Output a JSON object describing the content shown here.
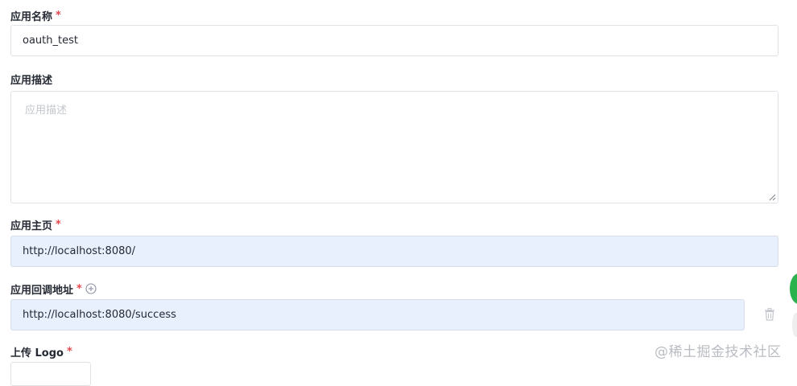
{
  "form": {
    "app_name": {
      "label": "应用名称",
      "required_mark": "*",
      "value": "oauth_test"
    },
    "app_desc": {
      "label": "应用描述",
      "placeholder": "应用描述",
      "value": ""
    },
    "app_home": {
      "label": "应用主页",
      "required_mark": "*",
      "value": "http://localhost:8080/"
    },
    "callback": {
      "label": "应用回调地址",
      "required_mark": "*",
      "value": "http://localhost:8080/success",
      "add_icon": "plus-circle-icon",
      "delete_icon": "trash-icon"
    },
    "logo": {
      "label": "上传 Logo",
      "required_mark": "*"
    }
  },
  "watermark": "@稀土掘金技术社区",
  "colors": {
    "required": "#e5484d",
    "autofill_bg": "#e8f0fe",
    "side_button": "#2bb24c"
  }
}
